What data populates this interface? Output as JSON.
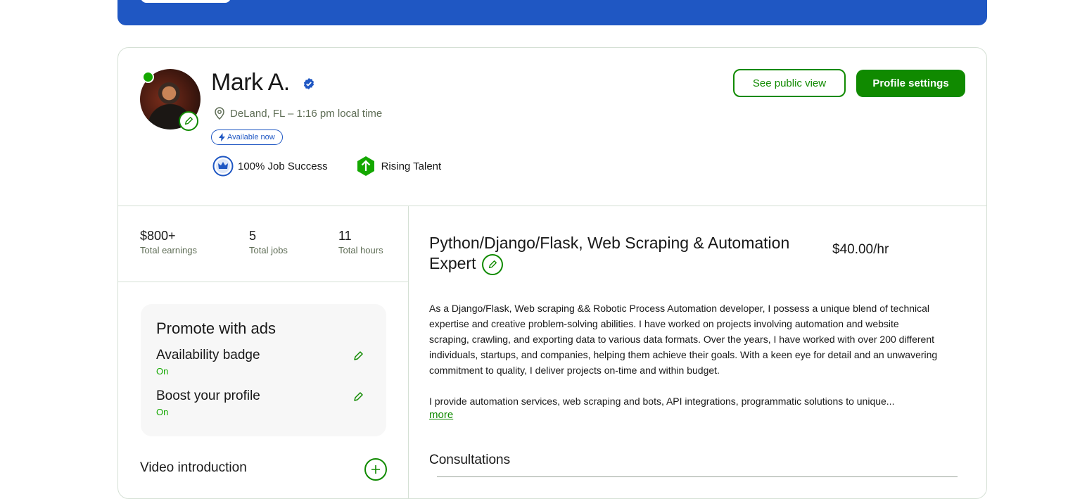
{
  "profile": {
    "name": "Mark A.",
    "location": "DeLand, FL – 1:16 pm local time",
    "availability_badge": "Available now",
    "job_success": "100% Job Success",
    "rising_talent": "Rising Talent"
  },
  "actions": {
    "public_view": "See public view",
    "settings": "Profile settings"
  },
  "stats": [
    {
      "value": "$800+",
      "label": "Total earnings"
    },
    {
      "value": "5",
      "label": "Total jobs"
    },
    {
      "value": "11",
      "label": "Total hours"
    }
  ],
  "promo": {
    "title": "Promote with ads",
    "items": [
      {
        "title": "Availability badge",
        "status": "On"
      },
      {
        "title": "Boost your profile",
        "status": "On"
      }
    ]
  },
  "video": {
    "label": "Video introduction"
  },
  "headline": {
    "title": "Python/Django/Flask, Web Scraping & Automation Expert",
    "rate": "$40.00/hr"
  },
  "overview": {
    "paragraph1": "As a Django/Flask, Web scraping && Robotic Process Automation developer, I possess a unique blend of technical expertise and creative problem-solving abilities. I have worked on projects involving automation and website scraping, crawling, and exporting data to various data formats. Over the years, I have worked with over 200 different individuals, startups, and companies, helping them achieve their goals. With a keen eye for detail and an unwavering commitment to quality, I deliver projects on-time and within budget.",
    "paragraph2": "I provide automation services, web scraping and bots, API integrations, programmatic solutions to unique...",
    "more": "more"
  },
  "consultations": {
    "title": "Consultations"
  },
  "colors": {
    "brand_green": "#108a00",
    "banner_blue": "#1f57c3",
    "online": "#14a800"
  }
}
